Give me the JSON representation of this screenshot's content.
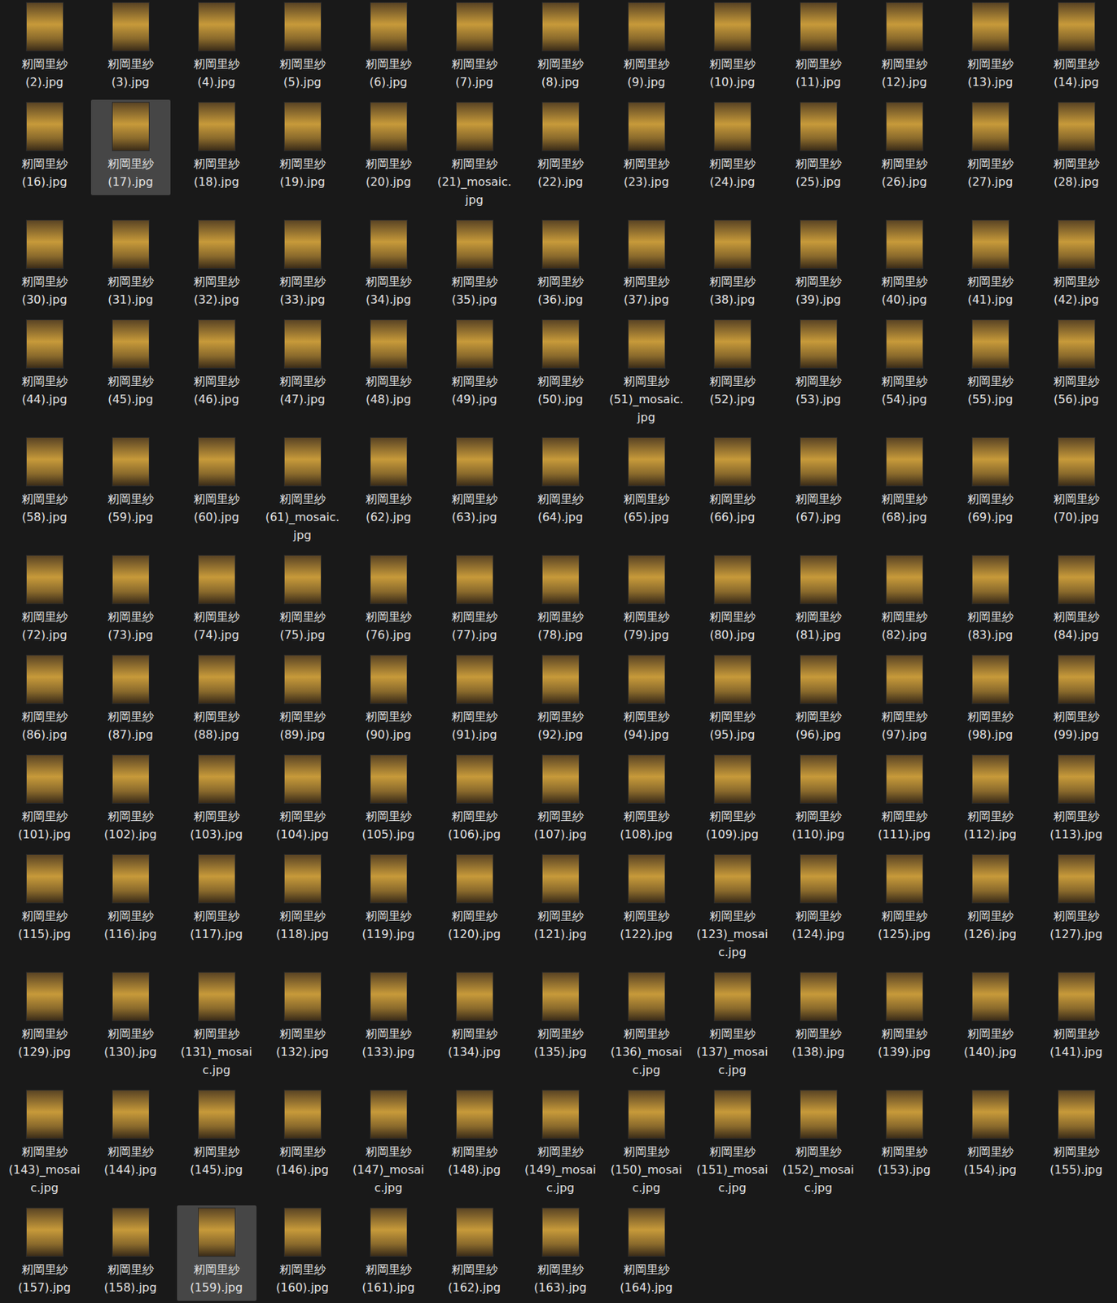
{
  "items": [
    {
      "name": "籾岡里紗 (2).jpg",
      "selected": false
    },
    {
      "name": "籾岡里紗 (3).jpg",
      "selected": false
    },
    {
      "name": "籾岡里紗 (4).jpg",
      "selected": false
    },
    {
      "name": "籾岡里紗 (5).jpg",
      "selected": false
    },
    {
      "name": "籾岡里紗 (6).jpg",
      "selected": false
    },
    {
      "name": "籾岡里紗 (7).jpg",
      "selected": false
    },
    {
      "name": "籾岡里紗 (8).jpg",
      "selected": false
    },
    {
      "name": "籾岡里紗 (9).jpg",
      "selected": false
    },
    {
      "name": "籾岡里紗 (10).jpg",
      "selected": false
    },
    {
      "name": "籾岡里紗 (11).jpg",
      "selected": false
    },
    {
      "name": "籾岡里紗 (12).jpg",
      "selected": false
    },
    {
      "name": "籾岡里紗 (13).jpg",
      "selected": false
    },
    {
      "name": "籾岡里紗 (14).jpg",
      "selected": false
    },
    {
      "name": "籾岡里紗 (16).jpg",
      "selected": false
    },
    {
      "name": "籾岡里紗 (17).jpg",
      "selected": true
    },
    {
      "name": "籾岡里紗 (18).jpg",
      "selected": false
    },
    {
      "name": "籾岡里紗 (19).jpg",
      "selected": false
    },
    {
      "name": "籾岡里紗 (20).jpg",
      "selected": false
    },
    {
      "name": "籾岡里紗 (21)_mosaic.jpg",
      "selected": false
    },
    {
      "name": "籾岡里紗 (22).jpg",
      "selected": false
    },
    {
      "name": "籾岡里紗 (23).jpg",
      "selected": false
    },
    {
      "name": "籾岡里紗 (24).jpg",
      "selected": false
    },
    {
      "name": "籾岡里紗 (25).jpg",
      "selected": false
    },
    {
      "name": "籾岡里紗 (26).jpg",
      "selected": false
    },
    {
      "name": "籾岡里紗 (27).jpg",
      "selected": false
    },
    {
      "name": "籾岡里紗 (28).jpg",
      "selected": false
    },
    {
      "name": "籾岡里紗 (30).jpg",
      "selected": false
    },
    {
      "name": "籾岡里紗 (31).jpg",
      "selected": false
    },
    {
      "name": "籾岡里紗 (32).jpg",
      "selected": false
    },
    {
      "name": "籾岡里紗 (33).jpg",
      "selected": false
    },
    {
      "name": "籾岡里紗 (34).jpg",
      "selected": false
    },
    {
      "name": "籾岡里紗 (35).jpg",
      "selected": false
    },
    {
      "name": "籾岡里紗 (36).jpg",
      "selected": false
    },
    {
      "name": "籾岡里紗 (37).jpg",
      "selected": false
    },
    {
      "name": "籾岡里紗 (38).jpg",
      "selected": false
    },
    {
      "name": "籾岡里紗 (39).jpg",
      "selected": false
    },
    {
      "name": "籾岡里紗 (40).jpg",
      "selected": false
    },
    {
      "name": "籾岡里紗 (41).jpg",
      "selected": false
    },
    {
      "name": "籾岡里紗 (42).jpg",
      "selected": false
    },
    {
      "name": "籾岡里紗 (44).jpg",
      "selected": false
    },
    {
      "name": "籾岡里紗 (45).jpg",
      "selected": false
    },
    {
      "name": "籾岡里紗 (46).jpg",
      "selected": false
    },
    {
      "name": "籾岡里紗 (47).jpg",
      "selected": false
    },
    {
      "name": "籾岡里紗 (48).jpg",
      "selected": false
    },
    {
      "name": "籾岡里紗 (49).jpg",
      "selected": false
    },
    {
      "name": "籾岡里紗 (50).jpg",
      "selected": false
    },
    {
      "name": "籾岡里紗 (51)_mosaic.jpg",
      "selected": false
    },
    {
      "name": "籾岡里紗 (52).jpg",
      "selected": false
    },
    {
      "name": "籾岡里紗 (53).jpg",
      "selected": false
    },
    {
      "name": "籾岡里紗 (54).jpg",
      "selected": false
    },
    {
      "name": "籾岡里紗 (55).jpg",
      "selected": false
    },
    {
      "name": "籾岡里紗 (56).jpg",
      "selected": false
    },
    {
      "name": "籾岡里紗 (58).jpg",
      "selected": false
    },
    {
      "name": "籾岡里紗 (59).jpg",
      "selected": false
    },
    {
      "name": "籾岡里紗 (60).jpg",
      "selected": false
    },
    {
      "name": "籾岡里紗 (61)_mosaic.jpg",
      "selected": false
    },
    {
      "name": "籾岡里紗 (62).jpg",
      "selected": false
    },
    {
      "name": "籾岡里紗 (63).jpg",
      "selected": false
    },
    {
      "name": "籾岡里紗 (64).jpg",
      "selected": false
    },
    {
      "name": "籾岡里紗 (65).jpg",
      "selected": false
    },
    {
      "name": "籾岡里紗 (66).jpg",
      "selected": false
    },
    {
      "name": "籾岡里紗 (67).jpg",
      "selected": false
    },
    {
      "name": "籾岡里紗 (68).jpg",
      "selected": false
    },
    {
      "name": "籾岡里紗 (69).jpg",
      "selected": false
    },
    {
      "name": "籾岡里紗 (70).jpg",
      "selected": false
    },
    {
      "name": "籾岡里紗 (72).jpg",
      "selected": false
    },
    {
      "name": "籾岡里紗 (73).jpg",
      "selected": false
    },
    {
      "name": "籾岡里紗 (74).jpg",
      "selected": false
    },
    {
      "name": "籾岡里紗 (75).jpg",
      "selected": false
    },
    {
      "name": "籾岡里紗 (76).jpg",
      "selected": false
    },
    {
      "name": "籾岡里紗 (77).jpg",
      "selected": false
    },
    {
      "name": "籾岡里紗 (78).jpg",
      "selected": false
    },
    {
      "name": "籾岡里紗 (79).jpg",
      "selected": false
    },
    {
      "name": "籾岡里紗 (80).jpg",
      "selected": false
    },
    {
      "name": "籾岡里紗 (81).jpg",
      "selected": false
    },
    {
      "name": "籾岡里紗 (82).jpg",
      "selected": false
    },
    {
      "name": "籾岡里紗 (83).jpg",
      "selected": false
    },
    {
      "name": "籾岡里紗 (84).jpg",
      "selected": false
    },
    {
      "name": "籾岡里紗 (86).jpg",
      "selected": false
    },
    {
      "name": "籾岡里紗 (87).jpg",
      "selected": false
    },
    {
      "name": "籾岡里紗 (88).jpg",
      "selected": false
    },
    {
      "name": "籾岡里紗 (89).jpg",
      "selected": false
    },
    {
      "name": "籾岡里紗 (90).jpg",
      "selected": false
    },
    {
      "name": "籾岡里紗 (91).jpg",
      "selected": false
    },
    {
      "name": "籾岡里紗 (92).jpg",
      "selected": false
    },
    {
      "name": "籾岡里紗 (94).jpg",
      "selected": false
    },
    {
      "name": "籾岡里紗 (95).jpg",
      "selected": false
    },
    {
      "name": "籾岡里紗 (96).jpg",
      "selected": false
    },
    {
      "name": "籾岡里紗 (97).jpg",
      "selected": false
    },
    {
      "name": "籾岡里紗 (98).jpg",
      "selected": false
    },
    {
      "name": "籾岡里紗 (99).jpg",
      "selected": false
    },
    {
      "name": "籾岡里紗 (101).jpg",
      "selected": false
    },
    {
      "name": "籾岡里紗 (102).jpg",
      "selected": false
    },
    {
      "name": "籾岡里紗 (103).jpg",
      "selected": false
    },
    {
      "name": "籾岡里紗 (104).jpg",
      "selected": false
    },
    {
      "name": "籾岡里紗 (105).jpg",
      "selected": false
    },
    {
      "name": "籾岡里紗 (106).jpg",
      "selected": false
    },
    {
      "name": "籾岡里紗 (107).jpg",
      "selected": false
    },
    {
      "name": "籾岡里紗 (108).jpg",
      "selected": false
    },
    {
      "name": "籾岡里紗 (109).jpg",
      "selected": false
    },
    {
      "name": "籾岡里紗 (110).jpg",
      "selected": false
    },
    {
      "name": "籾岡里紗 (111).jpg",
      "selected": false
    },
    {
      "name": "籾岡里紗 (112).jpg",
      "selected": false
    },
    {
      "name": "籾岡里紗 (113).jpg",
      "selected": false
    },
    {
      "name": "籾岡里紗 (115).jpg",
      "selected": false
    },
    {
      "name": "籾岡里紗 (116).jpg",
      "selected": false
    },
    {
      "name": "籾岡里紗 (117).jpg",
      "selected": false
    },
    {
      "name": "籾岡里紗 (118).jpg",
      "selected": false
    },
    {
      "name": "籾岡里紗 (119).jpg",
      "selected": false
    },
    {
      "name": "籾岡里紗 (120).jpg",
      "selected": false
    },
    {
      "name": "籾岡里紗 (121).jpg",
      "selected": false
    },
    {
      "name": "籾岡里紗 (122).jpg",
      "selected": false
    },
    {
      "name": "籾岡里紗 (123)_mosaic.jpg",
      "selected": false
    },
    {
      "name": "籾岡里紗 (124).jpg",
      "selected": false
    },
    {
      "name": "籾岡里紗 (125).jpg",
      "selected": false
    },
    {
      "name": "籾岡里紗 (126).jpg",
      "selected": false
    },
    {
      "name": "籾岡里紗 (127).jpg",
      "selected": false
    },
    {
      "name": "籾岡里紗 (129).jpg",
      "selected": false
    },
    {
      "name": "籾岡里紗 (130).jpg",
      "selected": false
    },
    {
      "name": "籾岡里紗 (131)_mosaic.jpg",
      "selected": false
    },
    {
      "name": "籾岡里紗 (132).jpg",
      "selected": false
    },
    {
      "name": "籾岡里紗 (133).jpg",
      "selected": false
    },
    {
      "name": "籾岡里紗 (134).jpg",
      "selected": false
    },
    {
      "name": "籾岡里紗 (135).jpg",
      "selected": false
    },
    {
      "name": "籾岡里紗 (136)_mosaic.jpg",
      "selected": false
    },
    {
      "name": "籾岡里紗 (137)_mosaic.jpg",
      "selected": false
    },
    {
      "name": "籾岡里紗 (138).jpg",
      "selected": false
    },
    {
      "name": "籾岡里紗 (139).jpg",
      "selected": false
    },
    {
      "name": "籾岡里紗 (140).jpg",
      "selected": false
    },
    {
      "name": "籾岡里紗 (141).jpg",
      "selected": false
    },
    {
      "name": "籾岡里紗 (143)_mosaic.jpg",
      "selected": false
    },
    {
      "name": "籾岡里紗 (144).jpg",
      "selected": false
    },
    {
      "name": "籾岡里紗 (145).jpg",
      "selected": false
    },
    {
      "name": "籾岡里紗 (146).jpg",
      "selected": false
    },
    {
      "name": "籾岡里紗 (147)_mosaic.jpg",
      "selected": false
    },
    {
      "name": "籾岡里紗 (148).jpg",
      "selected": false
    },
    {
      "name": "籾岡里紗 (149)_mosaic.jpg",
      "selected": false
    },
    {
      "name": "籾岡里紗 (150)_mosaic.jpg",
      "selected": false
    },
    {
      "name": "籾岡里紗 (151)_mosaic.jpg",
      "selected": false
    },
    {
      "name": "籾岡里紗 (152)_mosaic.jpg",
      "selected": false
    },
    {
      "name": "籾岡里紗 (153).jpg",
      "selected": false
    },
    {
      "name": "籾岡里紗 (154).jpg",
      "selected": false
    },
    {
      "name": "籾岡里紗 (155).jpg",
      "selected": false
    },
    {
      "name": "籾岡里紗 (157).jpg",
      "selected": false
    },
    {
      "name": "籾岡里紗 (158).jpg",
      "selected": false
    },
    {
      "name": "籾岡里紗 (159).jpg",
      "selected": true
    },
    {
      "name": "籾岡里紗 (160).jpg",
      "selected": false
    },
    {
      "name": "籾岡里紗 (161).jpg",
      "selected": false
    },
    {
      "name": "籾岡里紗 (162).jpg",
      "selected": false
    },
    {
      "name": "籾岡里紗 (163).jpg",
      "selected": false
    },
    {
      "name": "籾岡里紗 (164).jpg",
      "selected": false
    }
  ]
}
